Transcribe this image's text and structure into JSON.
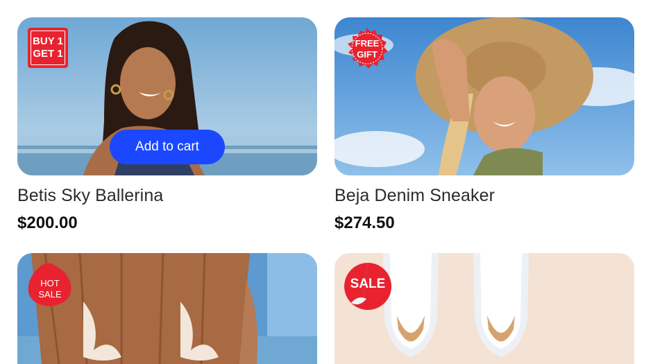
{
  "products": [
    {
      "name": "Betis Sky Ballerina",
      "price": "$200.00",
      "badge": {
        "line1": "BUY 1",
        "line2": "GET 1",
        "color": "#e8232f"
      },
      "button": "Add to cart"
    },
    {
      "name": "Beja Denim Sneaker",
      "price": "$274.50",
      "badge": {
        "line1": "FREE",
        "line2": "GIFT",
        "color": "#e8232f"
      }
    },
    {
      "badge": {
        "line1": "HOT",
        "line2": "SALE",
        "color": "#e8232f"
      }
    },
    {
      "badge": {
        "line1": "SALE",
        "color": "#e8232f"
      }
    }
  ],
  "colors": {
    "accent": "#1b48ff",
    "badge": "#e8232f"
  }
}
